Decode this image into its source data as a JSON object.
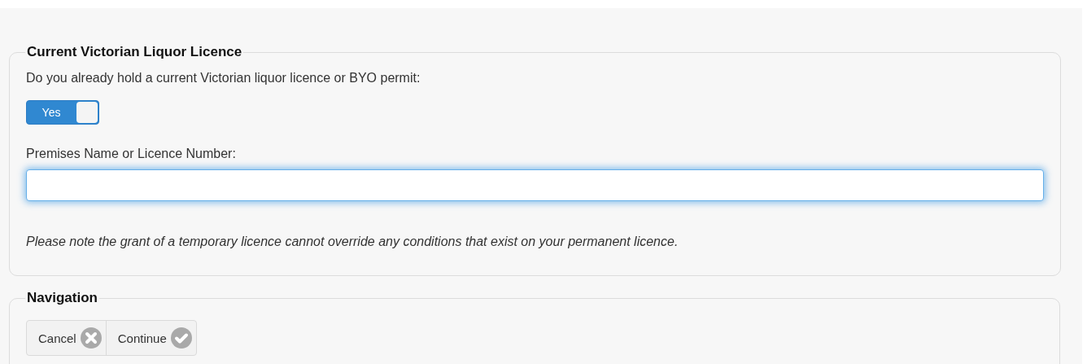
{
  "sections": [
    {
      "kind": "licence",
      "legend": "Current Victorian Liquor Licence",
      "question": "Do you already hold a current Victorian liquor licence or BYO permit:",
      "toggle": {
        "label": "Yes",
        "on": true
      },
      "field_label": "Premises Name or Licence Number:",
      "field": {
        "focused": true
      },
      "note": "Please note the grant of a temporary licence cannot override any conditions that exist on your permanent licence."
    },
    {
      "kind": "navigation",
      "legend": "Navigation",
      "buttons": [
        {
          "label": "Cancel",
          "kind": "cancel"
        },
        {
          "label": "Continue",
          "kind": "continue"
        }
      ]
    }
  ]
}
